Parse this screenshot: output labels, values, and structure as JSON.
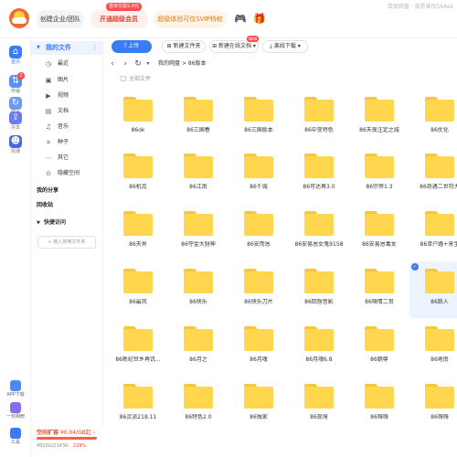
{
  "topbar": {
    "create_label": "创建企业/团队",
    "member_label": "开通超级会员",
    "member_badge": "首单仅需9.9元",
    "svip_label": "超级体验可仅SVIP特权",
    "user_info": "百度网盘 · 我是谁找564ex"
  },
  "rail": [
    {
      "label": "首页",
      "color": "#3a7cf6"
    },
    {
      "label": "传输",
      "color": "#5b8ff9",
      "badge": "1"
    },
    {
      "label": "同步",
      "color": "#6b9af7"
    },
    {
      "label": "共享",
      "color": "#6c7cf0"
    },
    {
      "label": "找课",
      "color": "#4b6bd8"
    }
  ],
  "rail_lower": [
    {
      "label": "APP下载",
      "color": "#4a8af7"
    },
    {
      "label": "一刻相册",
      "color": "#8a6cf0"
    },
    {
      "label": "工具",
      "color": "#3a7cf6"
    }
  ],
  "sidebar": {
    "header": "我的文件",
    "items": [
      {
        "icon": "◷",
        "label": "最近"
      },
      {
        "icon": "▣",
        "label": "图片"
      },
      {
        "icon": "▶",
        "label": "视频"
      },
      {
        "icon": "▤",
        "label": "文档"
      },
      {
        "icon": "♫",
        "label": "音乐"
      },
      {
        "icon": "⌗",
        "label": "种子"
      },
      {
        "icon": "⋯",
        "label": "其它"
      },
      {
        "icon": "⊙",
        "label": "隐藏空间"
      }
    ],
    "my_share": "我的分享",
    "recycle": "回收站",
    "quick_access": "快捷访问",
    "add_folder": "+ 拖入常用文件夹"
  },
  "storage": {
    "expand_label": "空间扩容",
    "price": "¥0.04/GB起 ›",
    "used": "4920G/2143G",
    "percent": "229%",
    "fill_fraction": 1.0
  },
  "toolbar": {
    "upload": "上传",
    "new_folder": "新建文件夹",
    "new_online_doc": "新建在线文档",
    "new_badge": "NEW",
    "offline_download": "离线下载"
  },
  "breadcrumb": {
    "root": "我的网盘",
    "sep": ">",
    "current": "86版本"
  },
  "all_files_label": "全部文件",
  "folders": [
    "86ok",
    "86三国春",
    "86三国版本",
    "86中变特色",
    "86天夜注定之城",
    "86优化",
    "86机克",
    "86江南",
    "86千城",
    "86可达再3.0",
    "86宗帝1.3",
    "86奇遇二世符大",
    "86天界",
    "86夺金大财神",
    "86安而恩",
    "86安易恩女鬼9158",
    "86安易恩毒女",
    "86单户路+来宝",
    "86最风",
    "86快乐",
    "86快乐刀片",
    "86回想音影",
    "86嗨情二贯",
    "86跃人",
    "86新纪世乡再饥...",
    "86月之",
    "86月魂",
    "86月魂6.8",
    "86朝尊",
    "86地南",
    "86灵派218.11",
    "86特色2.0",
    "86独家",
    "86现境",
    "86嗨嗨",
    "86嗨嗨"
  ],
  "selected_folder_index": 23
}
